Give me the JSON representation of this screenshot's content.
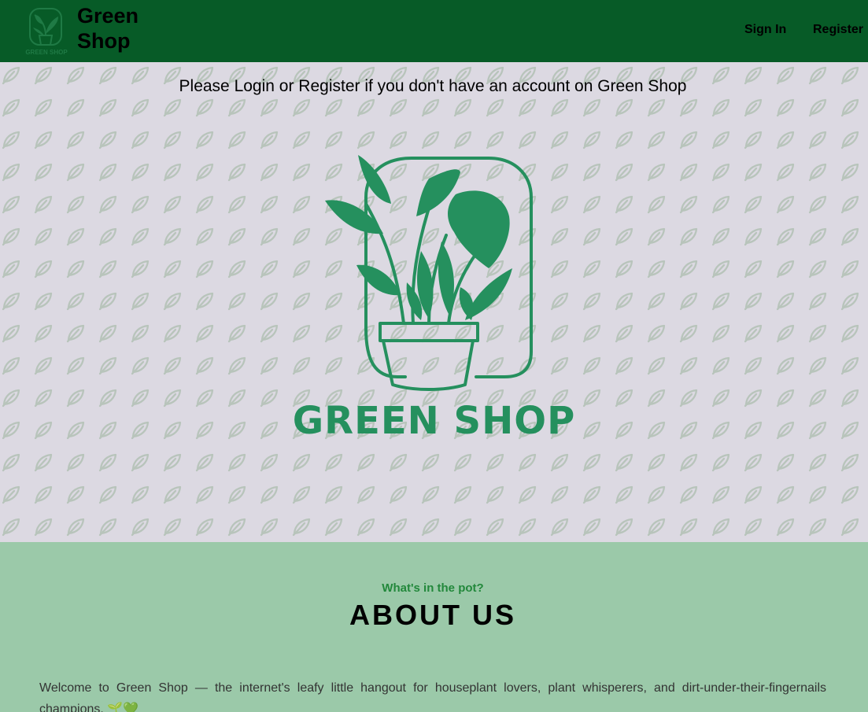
{
  "header": {
    "logo_mark_text": "GREEN SHOP",
    "brand_name": "Green Shop",
    "nav": {
      "signin_label": "Sign In",
      "register_label": "Register"
    }
  },
  "hero": {
    "message": "Please Login or Register if you don't have an account on Green Shop",
    "logo_text": "GREEN SHOP"
  },
  "about": {
    "eyebrow": "What's in the pot?",
    "title": "ABOUT US",
    "body": "Welcome to Green Shop — the internet's leafy little hangout for houseplant lovers, plant whisperers, and dirt-under-their-fingernails champions. 🌱💚"
  },
  "colors": {
    "navbar": "#075b27",
    "hero_background": "#dcd9e2",
    "pattern_leaf": "#b8c4bb",
    "logo_green": "#25905e",
    "about_background": "#9bc9a9",
    "eyebrow_green": "#22883b"
  },
  "icons": {
    "nav_logo": "potted-plant-logo-icon",
    "hero_logo": "potted-plant-logo-icon",
    "pattern": "leaf-icon"
  }
}
